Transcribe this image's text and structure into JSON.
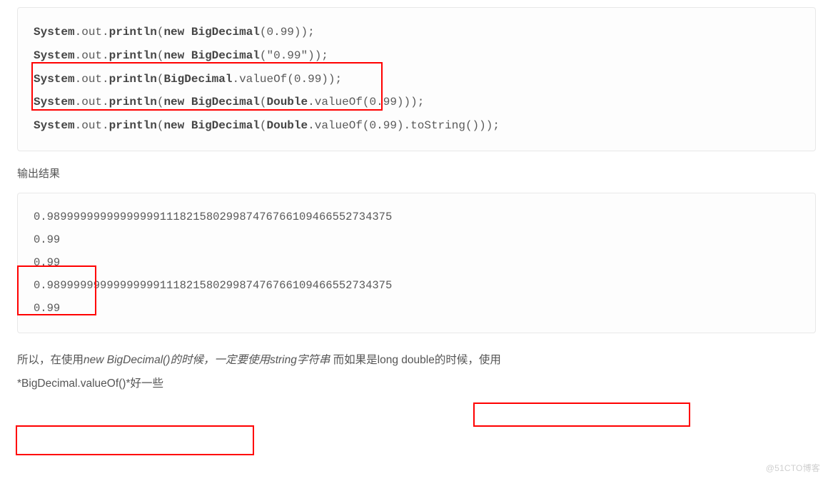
{
  "code": {
    "l1": {
      "sys": "System",
      "out": ".out.",
      "println": "println",
      "open": "(",
      "nw": "new",
      "sp": " ",
      "bd": "BigDecimal",
      "args": "(0.99));"
    },
    "l2": {
      "sys": "System",
      "out": ".out.",
      "println": "println",
      "open": "(",
      "nw": "new",
      "sp": " ",
      "bd": "BigDecimal",
      "args": "(\"0.99\"));"
    },
    "l3": {
      "sys": "System",
      "out": ".out.",
      "println": "println",
      "open": "(",
      "bd": "BigDecimal",
      "method": ".valueOf(0.99));"
    },
    "l4": {
      "sys": "System",
      "out": ".out.",
      "println": "println",
      "open": "(",
      "nw": "new",
      "sp": " ",
      "bd": "BigDecimal",
      "open2": "(",
      "dbl": "Double",
      "tail": ".valueOf(0.99)));"
    },
    "l5": {
      "sys": "System",
      "out": ".out.",
      "println": "println",
      "open": "(",
      "nw": "new",
      "sp": " ",
      "bd": "BigDecimal",
      "open2": "(",
      "dbl": "Double",
      "tail": ".valueOf(0.99).toString()));"
    }
  },
  "label_output": "输出结果",
  "output": {
    "l1": "0.98999999999999999111821580299874767661094665527343​75",
    "l2": "0.99",
    "l3": "0.99",
    "l4": "0.98999999999999999111821580299874767661094665527343​75",
    "l5": "0.99"
  },
  "summary": {
    "p1a": "所以，在使用",
    "p1b": "new BigDecimal()的时候，一定要使用string字符串",
    "p1c": " 而如果是long double的时候，使用",
    "p2a": "*BigDecimal.valueOf()*好一些"
  },
  "watermark": "@51CTO博客"
}
